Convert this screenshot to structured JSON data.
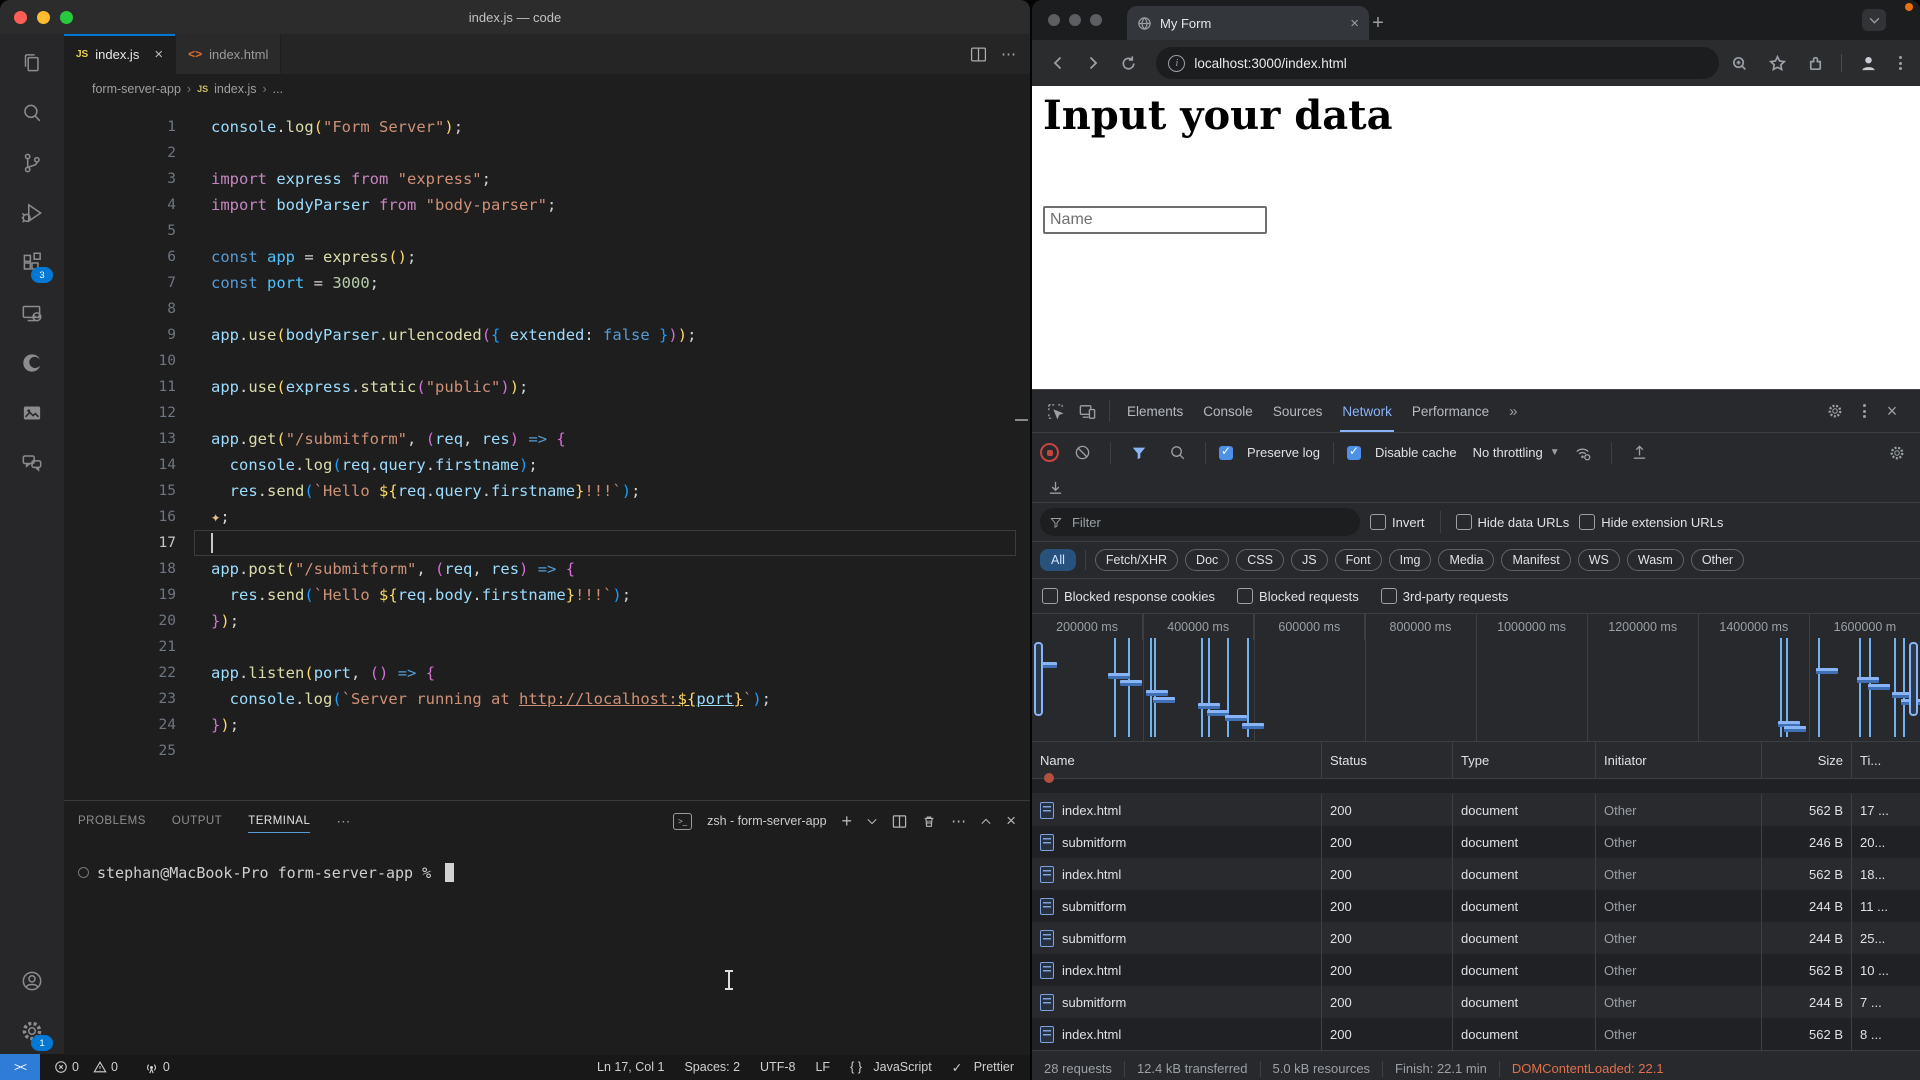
{
  "colors": {
    "vscode_accent": "#0078d4",
    "devtools_accent": "#8ab4f8",
    "record_red": "#c8443e",
    "dcl_orange": "#e2704c",
    "traffic_lights": [
      "#ff5f57",
      "#febc2e",
      "#28c840"
    ]
  },
  "vscode": {
    "window_title": "index.js — code",
    "tabs": [
      {
        "label": "index.js",
        "icon": "js",
        "active": true
      },
      {
        "label": "index.html",
        "icon": "html",
        "active": false
      }
    ],
    "breadcrumb": [
      "form-server-app",
      "index.js",
      "..."
    ],
    "activity": {
      "extensions_badge": "3",
      "settings_badge": "1"
    },
    "editor": {
      "current_line": 17,
      "lines": [
        {
          "segs": [
            [
              "console",
              "v"
            ],
            [
              ".",
              "p"
            ],
            [
              "log",
              "f"
            ],
            [
              "(",
              "bY"
            ],
            [
              "\"Form Server\"",
              "s"
            ],
            [
              ")",
              "bY"
            ],
            [
              ";",
              "p"
            ]
          ]
        },
        {
          "segs": []
        },
        {
          "segs": [
            [
              "import ",
              "k"
            ],
            [
              "express ",
              "v"
            ],
            [
              "from ",
              "k"
            ],
            [
              "\"express\"",
              "s"
            ],
            [
              ";",
              "p"
            ]
          ]
        },
        {
          "segs": [
            [
              "import ",
              "k"
            ],
            [
              "bodyParser ",
              "v"
            ],
            [
              "from ",
              "k"
            ],
            [
              "\"body-parser\"",
              "s"
            ],
            [
              ";",
              "p"
            ]
          ]
        },
        {
          "segs": []
        },
        {
          "segs": [
            [
              "const ",
              "kc"
            ],
            [
              "app ",
              "vb"
            ],
            [
              "= ",
              "p"
            ],
            [
              "express",
              "f"
            ],
            [
              "(",
              "bY"
            ],
            [
              ")",
              "bY"
            ],
            [
              ";",
              "p"
            ]
          ]
        },
        {
          "segs": [
            [
              "const ",
              "kc"
            ],
            [
              "port ",
              "vb"
            ],
            [
              "= ",
              "p"
            ],
            [
              "3000",
              "n"
            ],
            [
              ";",
              "p"
            ]
          ]
        },
        {
          "segs": []
        },
        {
          "segs": [
            [
              "app",
              "v"
            ],
            [
              ".",
              "p"
            ],
            [
              "use",
              "f"
            ],
            [
              "(",
              "bY"
            ],
            [
              "bodyParser",
              "v"
            ],
            [
              ".",
              "p"
            ],
            [
              "urlencoded",
              "f"
            ],
            [
              "(",
              "bP"
            ],
            [
              "{ ",
              "bB"
            ],
            [
              "extended",
              "v"
            ],
            [
              ": ",
              "p"
            ],
            [
              "false",
              "kc"
            ],
            [
              " ",
              "p"
            ],
            [
              "}",
              "bB"
            ],
            [
              ")",
              "bP"
            ],
            [
              ")",
              "bY"
            ],
            [
              ";",
              "p"
            ]
          ]
        },
        {
          "segs": []
        },
        {
          "segs": [
            [
              "app",
              "v"
            ],
            [
              ".",
              "p"
            ],
            [
              "use",
              "f"
            ],
            [
              "(",
              "bY"
            ],
            [
              "express",
              "v"
            ],
            [
              ".",
              "p"
            ],
            [
              "static",
              "f"
            ],
            [
              "(",
              "bP"
            ],
            [
              "\"public\"",
              "s"
            ],
            [
              ")",
              "bP"
            ],
            [
              ")",
              "bY"
            ],
            [
              ";",
              "p"
            ]
          ]
        },
        {
          "segs": []
        },
        {
          "segs": [
            [
              "app",
              "v"
            ],
            [
              ".",
              "p"
            ],
            [
              "get",
              "f"
            ],
            [
              "(",
              "bY"
            ],
            [
              "\"/submitform\"",
              "s"
            ],
            [
              ", ",
              "p"
            ],
            [
              "(",
              "bP"
            ],
            [
              "req",
              "v"
            ],
            [
              ", ",
              "p"
            ],
            [
              "res",
              "v"
            ],
            [
              ")",
              "bP"
            ],
            [
              " ",
              "p"
            ],
            [
              "=>",
              "kc"
            ],
            [
              " ",
              "p"
            ],
            [
              "{",
              "bP"
            ]
          ]
        },
        {
          "segs": [
            [
              "  console",
              "v"
            ],
            [
              ".",
              "p"
            ],
            [
              "log",
              "f"
            ],
            [
              "(",
              "bB"
            ],
            [
              "req",
              "v"
            ],
            [
              ".",
              "p"
            ],
            [
              "query",
              "v"
            ],
            [
              ".",
              "p"
            ],
            [
              "firstname",
              "v"
            ],
            [
              ")",
              "bB"
            ],
            [
              ";",
              "p"
            ]
          ]
        },
        {
          "segs": [
            [
              "  res",
              "v"
            ],
            [
              ".",
              "p"
            ],
            [
              "send",
              "f"
            ],
            [
              "(",
              "bB"
            ],
            [
              "`Hello ",
              "s"
            ],
            [
              "${",
              "bY"
            ],
            [
              "req",
              "v"
            ],
            [
              ".",
              "p"
            ],
            [
              "query",
              "v"
            ],
            [
              ".",
              "p"
            ],
            [
              "firstname",
              "v"
            ],
            [
              "}",
              "bY"
            ],
            [
              "!!!`",
              "s"
            ],
            [
              ")",
              "bB"
            ],
            [
              ";",
              "p"
            ]
          ]
        },
        {
          "segs": [
            [
              "✦",
              "spark"
            ],
            [
              ";",
              "p"
            ]
          ]
        },
        {
          "segs": []
        },
        {
          "segs": [
            [
              "app",
              "v"
            ],
            [
              ".",
              "p"
            ],
            [
              "post",
              "f"
            ],
            [
              "(",
              "bY"
            ],
            [
              "\"/submitform\"",
              "s"
            ],
            [
              ", ",
              "p"
            ],
            [
              "(",
              "bP"
            ],
            [
              "req",
              "v"
            ],
            [
              ", ",
              "p"
            ],
            [
              "res",
              "v"
            ],
            [
              ")",
              "bP"
            ],
            [
              " ",
              "p"
            ],
            [
              "=>",
              "kc"
            ],
            [
              " ",
              "p"
            ],
            [
              "{",
              "bP"
            ]
          ]
        },
        {
          "segs": [
            [
              "  res",
              "v"
            ],
            [
              ".",
              "p"
            ],
            [
              "send",
              "f"
            ],
            [
              "(",
              "bB"
            ],
            [
              "`Hello ",
              "s"
            ],
            [
              "${",
              "bY"
            ],
            [
              "req",
              "v"
            ],
            [
              ".",
              "p"
            ],
            [
              "body",
              "v"
            ],
            [
              ".",
              "p"
            ],
            [
              "firstname",
              "v"
            ],
            [
              "}",
              "bY"
            ],
            [
              "!!!`",
              "s"
            ],
            [
              ")",
              "bB"
            ],
            [
              ";",
              "p"
            ]
          ]
        },
        {
          "segs": [
            [
              "}",
              "bP"
            ],
            [
              ")",
              "bY"
            ],
            [
              ";",
              "p"
            ]
          ]
        },
        {
          "segs": []
        },
        {
          "segs": [
            [
              "app",
              "v"
            ],
            [
              ".",
              "p"
            ],
            [
              "listen",
              "f"
            ],
            [
              "(",
              "bY"
            ],
            [
              "port",
              "v"
            ],
            [
              ", ",
              "p"
            ],
            [
              "(",
              "bP"
            ],
            [
              ")",
              "bP"
            ],
            [
              " ",
              "p"
            ],
            [
              "=>",
              "kc"
            ],
            [
              " ",
              "p"
            ],
            [
              "{",
              "bP"
            ]
          ]
        },
        {
          "segs": [
            [
              "  console",
              "v"
            ],
            [
              ".",
              "p"
            ],
            [
              "log",
              "f"
            ],
            [
              "(",
              "bB"
            ],
            [
              "`Server running at ",
              "s"
            ],
            [
              "http://localhost:",
              "s u"
            ],
            [
              "${",
              "bY u"
            ],
            [
              "port",
              "v u"
            ],
            [
              "}",
              "bY u"
            ],
            [
              "`",
              "s"
            ],
            [
              ")",
              "bB"
            ],
            [
              ";",
              "p"
            ]
          ]
        },
        {
          "segs": [
            [
              "}",
              "bP"
            ],
            [
              ")",
              "bY"
            ],
            [
              ";",
              "p"
            ]
          ]
        },
        {
          "segs": []
        }
      ]
    },
    "panel": {
      "tabs": [
        "PROBLEMS",
        "OUTPUT",
        "TERMINAL"
      ],
      "active_tab": "TERMINAL",
      "more_label": "⋯",
      "shell_title": "zsh - form-server-app",
      "prompt": "stephan@MacBook-Pro form-server-app %"
    },
    "status": {
      "errors": "0",
      "warnings": "0",
      "ports": "0",
      "line_col": "Ln 17, Col 1",
      "indent": "Spaces: 2",
      "encoding": "UTF-8",
      "eol": "LF",
      "language": "JavaScript",
      "formatter": "Prettier",
      "formatter_check": "✓",
      "braces": "{ }"
    }
  },
  "chrome": {
    "tab_title": "My Form",
    "url": "localhost:3000/index.html",
    "page": {
      "heading": "Input your data",
      "input_placeholder": "Name"
    },
    "devtools": {
      "tabs": [
        "Elements",
        "Console",
        "Sources",
        "Network",
        "Performance"
      ],
      "active_tab": "Network",
      "more_tabs": "»",
      "toolbar": {
        "preserve_log": "Preserve log",
        "disable_cache": "Disable cache",
        "throttling": "No throttling"
      },
      "filter_row": {
        "placeholder": "Filter",
        "invert": "Invert",
        "hide_data_urls": "Hide data URLs",
        "hide_extension_urls": "Hide extension URLs"
      },
      "type_chips": [
        "All",
        "Fetch/XHR",
        "Doc",
        "CSS",
        "JS",
        "Font",
        "Img",
        "Media",
        "Manifest",
        "WS",
        "Wasm",
        "Other"
      ],
      "active_chip": "All",
      "request_checks": [
        "Blocked response cookies",
        "Blocked requests",
        "3rd-party requests"
      ],
      "timeline": {
        "ticks": [
          "200000 ms",
          "400000 ms",
          "600000 ms",
          "800000 ms",
          "1000000 ms",
          "1200000 ms",
          "1400000 ms",
          "1600000 m"
        ],
        "vlines": [
          9.2,
          10.8,
          13.3,
          13.7,
          19.0,
          19.8,
          22.0,
          24.2,
          84.2,
          84.9,
          88.5,
          93.1,
          94.3,
          97.1,
          98.1
        ],
        "bars": [
          [
            0.3,
            24
          ],
          [
            8.6,
            36
          ],
          [
            9.9,
            44
          ],
          [
            12.8,
            54
          ],
          [
            13.6,
            62
          ],
          [
            18.7,
            68
          ],
          [
            19.7,
            76
          ],
          [
            21.7,
            82
          ],
          [
            23.6,
            90
          ],
          [
            84.0,
            88
          ],
          [
            84.7,
            94
          ],
          [
            88.3,
            30
          ],
          [
            92.9,
            40
          ],
          [
            94.1,
            48
          ],
          [
            96.9,
            56
          ],
          [
            97.9,
            64
          ]
        ]
      },
      "table": {
        "columns": [
          "Name",
          "Status",
          "Type",
          "Initiator",
          "Size",
          "Ti..."
        ],
        "rows": [
          {
            "name": "index.html",
            "status": "200",
            "type": "document",
            "initiator": "Other",
            "size": "562 B",
            "time": "17 ..."
          },
          {
            "name": "submitform",
            "status": "200",
            "type": "document",
            "initiator": "Other",
            "size": "246 B",
            "time": "20..."
          },
          {
            "name": "index.html",
            "status": "200",
            "type": "document",
            "initiator": "Other",
            "size": "562 B",
            "time": "18..."
          },
          {
            "name": "submitform",
            "status": "200",
            "type": "document",
            "initiator": "Other",
            "size": "244 B",
            "time": "11 ..."
          },
          {
            "name": "submitform",
            "status": "200",
            "type": "document",
            "initiator": "Other",
            "size": "244 B",
            "time": "25..."
          },
          {
            "name": "index.html",
            "status": "200",
            "type": "document",
            "initiator": "Other",
            "size": "562 B",
            "time": "10 ..."
          },
          {
            "name": "submitform",
            "status": "200",
            "type": "document",
            "initiator": "Other",
            "size": "244 B",
            "time": "7 ..."
          },
          {
            "name": "index.html",
            "status": "200",
            "type": "document",
            "initiator": "Other",
            "size": "562 B",
            "time": "8 ..."
          }
        ]
      },
      "summary": [
        "28 requests",
        "12.4 kB transferred",
        "5.0 kB resources",
        "Finish: 22.1 min",
        "DOMContentLoaded: 22.1"
      ]
    }
  }
}
